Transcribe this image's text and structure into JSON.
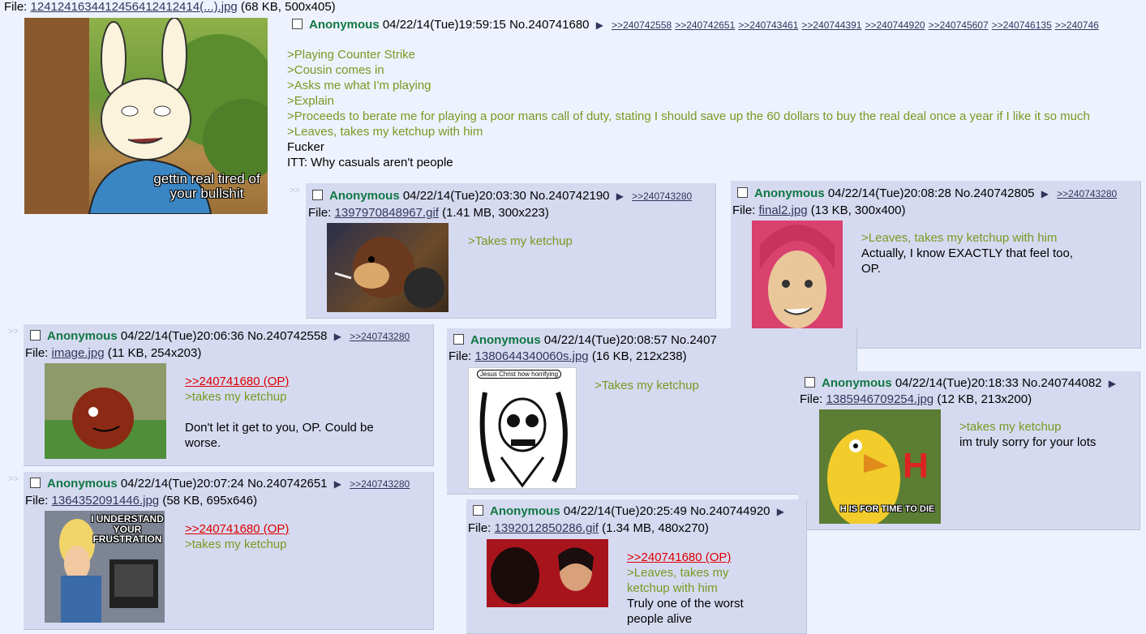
{
  "op": {
    "file_label": "File:",
    "file_name": "124124163441245641241241​4(...).jpg",
    "file_meta": "(68 KB, 500x405)",
    "name": "Anonymous",
    "datetime": "04/22/14(Tue)19:59:15",
    "post_no": "No.240741680",
    "backlinks": [
      ">>240742558",
      ">>240742651",
      ">>240743461",
      ">>240744391",
      ">>240744920",
      ">>240745607",
      ">>240746135",
      ">>240746"
    ],
    "image_caption": "gettin real tired of your bullshit",
    "lines": [
      {
        "text": ">Playing Counter Strike",
        "quote": true
      },
      {
        "text": ">Cousin comes in",
        "quote": true
      },
      {
        "text": ">Asks me what I'm playing",
        "quote": true
      },
      {
        "text": ">Explain",
        "quote": true
      },
      {
        "text": ">Proceeds to berate me for playing a poor mans call of duty, stating I should save up the 60 dollars to buy the real deal once a year if I like it so much",
        "quote": true
      },
      {
        "text": ">Leaves, takes my ketchup with him",
        "quote": true
      },
      {
        "text": "Fucker",
        "quote": false
      },
      {
        "text": "ITT: Why casuals aren't people",
        "quote": false
      }
    ]
  },
  "replies": {
    "r742190": {
      "name": "Anonymous",
      "datetime": "04/22/14(Tue)20:03:30",
      "post_no": "No.240742190",
      "backlinks": [
        ">>240743280"
      ],
      "file_label": "File:",
      "file_name": "1397970848967.gif",
      "file_meta": "(1.41 MB, 300x223)",
      "lines": [
        ">Takes my ketchup"
      ]
    },
    "r742805": {
      "name": "Anonymous",
      "datetime": "04/22/14(Tue)20:08:28",
      "post_no": "No.240742805",
      "backlinks": [
        ">>240743280"
      ],
      "file_label": "File:",
      "file_name": "final2.jpg",
      "file_meta": "(13 KB, 300x400)",
      "quote": ">Leaves, takes my ketchup with him",
      "text1": "Actually, I know EXACTLY that feel too,",
      "text2": "OP."
    },
    "r742558": {
      "name": "Anonymous",
      "datetime": "04/22/14(Tue)20:06:36",
      "post_no": "No.240742558",
      "backlinks": [
        ">>240743280"
      ],
      "file_label": "File:",
      "file_name": "image.jpg",
      "file_meta": "(11 KB, 254x203)",
      "op_link": ">>240741680 (OP)",
      "quote": ">takes my ketchup",
      "text1": "Don't let it get to you, OP. Could be",
      "text2": "worse."
    },
    "r742651": {
      "name": "Anonymous",
      "datetime": "04/22/14(Tue)20:07:24",
      "post_no": "No.240742651",
      "backlinks": [
        ">>240743280"
      ],
      "file_label": "File:",
      "file_name": "1364352091446.jpg",
      "file_meta": "(58 KB, 695x646)",
      "op_link": ">>240741680 (OP)",
      "quote": ">takes my ketchup",
      "image_caption": "I UNDERSTAND YOUR FRUSTRATION"
    },
    "r742857": {
      "name": "Anonymous",
      "datetime": "04/22/14(Tue)20:08:57",
      "post_no": "No.2407",
      "file_label": "File:",
      "file_name": "1380644340060s.jpg",
      "file_meta": "(16 KB, 212x238)",
      "quote": ">Takes my ketchup",
      "image_caption": "Jesus Christ how horrifying"
    },
    "r744082": {
      "name": "Anonymous",
      "datetime": "04/22/14(Tue)20:18:33",
      "post_no": "No.240744082",
      "file_label": "File:",
      "file_name": "1385946709254.jpg",
      "file_meta": "(12 KB, 213x200)",
      "quote": ">takes my ketchup",
      "text1": "im truly sorry for your lots",
      "image_caption": "H IS FOR TIME TO DIE",
      "image_letter": "H"
    },
    "r744920": {
      "name": "Anonymous",
      "datetime": "04/22/14(Tue)20:25:49",
      "post_no": "No.240744920",
      "file_label": "File:",
      "file_name": "1392012850286.gif",
      "file_meta": "(1.34 MB, 480x270)",
      "op_link": ">>240741680 (OP)",
      "quote1": ">Leaves, takes my",
      "quote2": "ketchup with him",
      "text1": "Truly one of the worst",
      "text2": "people alive"
    }
  },
  "separator": ">>",
  "icons": {
    "checkbox": "checkbox-icon",
    "arrow": "menu-arrow-icon"
  },
  "colors": {
    "background": "#eef2ff",
    "reply_bg": "#d6daf0",
    "name": "#117743",
    "greentext": "#789922",
    "quotelink": "#dd0000",
    "link": "#34345c"
  }
}
